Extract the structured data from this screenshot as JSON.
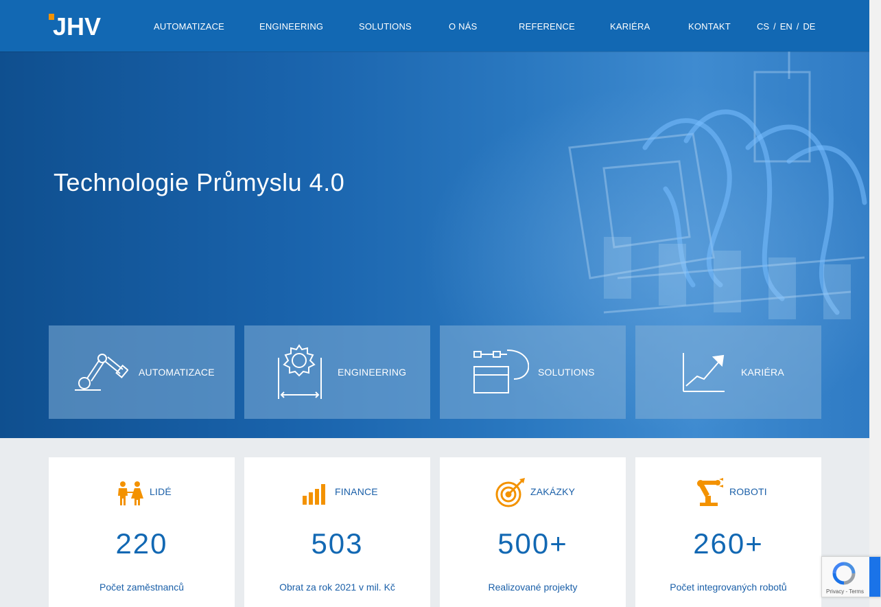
{
  "header": {
    "logo_text": "JHV",
    "nav": [
      "AUTOMATIZACE",
      "ENGINEERING",
      "SOLUTIONS",
      "O NÁS",
      "REFERENCE",
      "KARIÉRA",
      "KONTAKT"
    ],
    "languages": [
      "CS",
      "EN",
      "DE"
    ],
    "language_separator": "/"
  },
  "hero": {
    "title": "Technologie Průmyslu 4.0",
    "tiles": [
      {
        "label": "AUTOMATIZACE",
        "icon": "robot-arm-icon"
      },
      {
        "label": "ENGINEERING",
        "icon": "gear-measure-icon"
      },
      {
        "label": "SOLUTIONS",
        "icon": "connected-box-icon"
      },
      {
        "label": "KARIÉRA",
        "icon": "growth-chart-icon"
      }
    ]
  },
  "stats": [
    {
      "label": "LIDÉ",
      "value": "220",
      "desc": "Počet zaměstnanců",
      "icon": "people-icon"
    },
    {
      "label": "FINANCE",
      "value": "503",
      "desc": "Obrat za rok 2021 v mil. Kč",
      "icon": "bar-chart-icon"
    },
    {
      "label": "ZAKÁZKY",
      "value": "500+",
      "desc": "Realizované projekty",
      "icon": "target-icon"
    },
    {
      "label": "ROBOTI",
      "value": "260+",
      "desc": "Počet integrovaných robotů",
      "icon": "industrial-robot-icon"
    }
  ],
  "recaptcha": {
    "links": "Privacy - Terms"
  },
  "colors": {
    "brand_blue": "#1268b3",
    "accent_orange": "#f39200",
    "text_blue": "#1a5fa8"
  }
}
